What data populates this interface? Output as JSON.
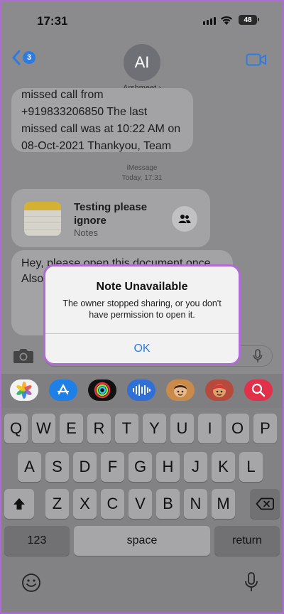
{
  "status_bar": {
    "time": "17:31",
    "battery": "48"
  },
  "nav": {
    "back_badge": "3",
    "avatar_initials": "AI",
    "contact_name": "Arshmeet"
  },
  "messages": {
    "missed_call_text": "missed call from +919833206850 The last missed call was at 10:22 AM on 08-Oct-2021 Thankyou, Team Jio.",
    "service": "iMessage",
    "timestamp": "Today, 17:31",
    "note_title": "Testing please ignore",
    "note_app": "Notes",
    "doc_text": "Hey, please open this document once Also will s thec"
  },
  "input": {
    "placeholder": ""
  },
  "dialog": {
    "title": "Note Unavailable",
    "message": "The owner stopped sharing, or you don't have permission to open it.",
    "ok_label": "OK"
  },
  "app_strip": [
    "photos-icon",
    "app-store-icon",
    "activity-icon",
    "audio-icon",
    "memoji-icon",
    "memoji-2-icon",
    "web-search-icon"
  ],
  "keyboard": {
    "row1": [
      "Q",
      "W",
      "E",
      "R",
      "T",
      "Y",
      "U",
      "I",
      "O",
      "P"
    ],
    "row2": [
      "A",
      "S",
      "D",
      "F",
      "G",
      "H",
      "J",
      "K",
      "L"
    ],
    "row3": [
      "Z",
      "X",
      "C",
      "V",
      "B",
      "N",
      "M"
    ],
    "numbers_key": "123",
    "space_key": "space",
    "return_key": "return"
  },
  "colors": {
    "accent": "#2e7be0",
    "highlight": "#b06ad9"
  }
}
